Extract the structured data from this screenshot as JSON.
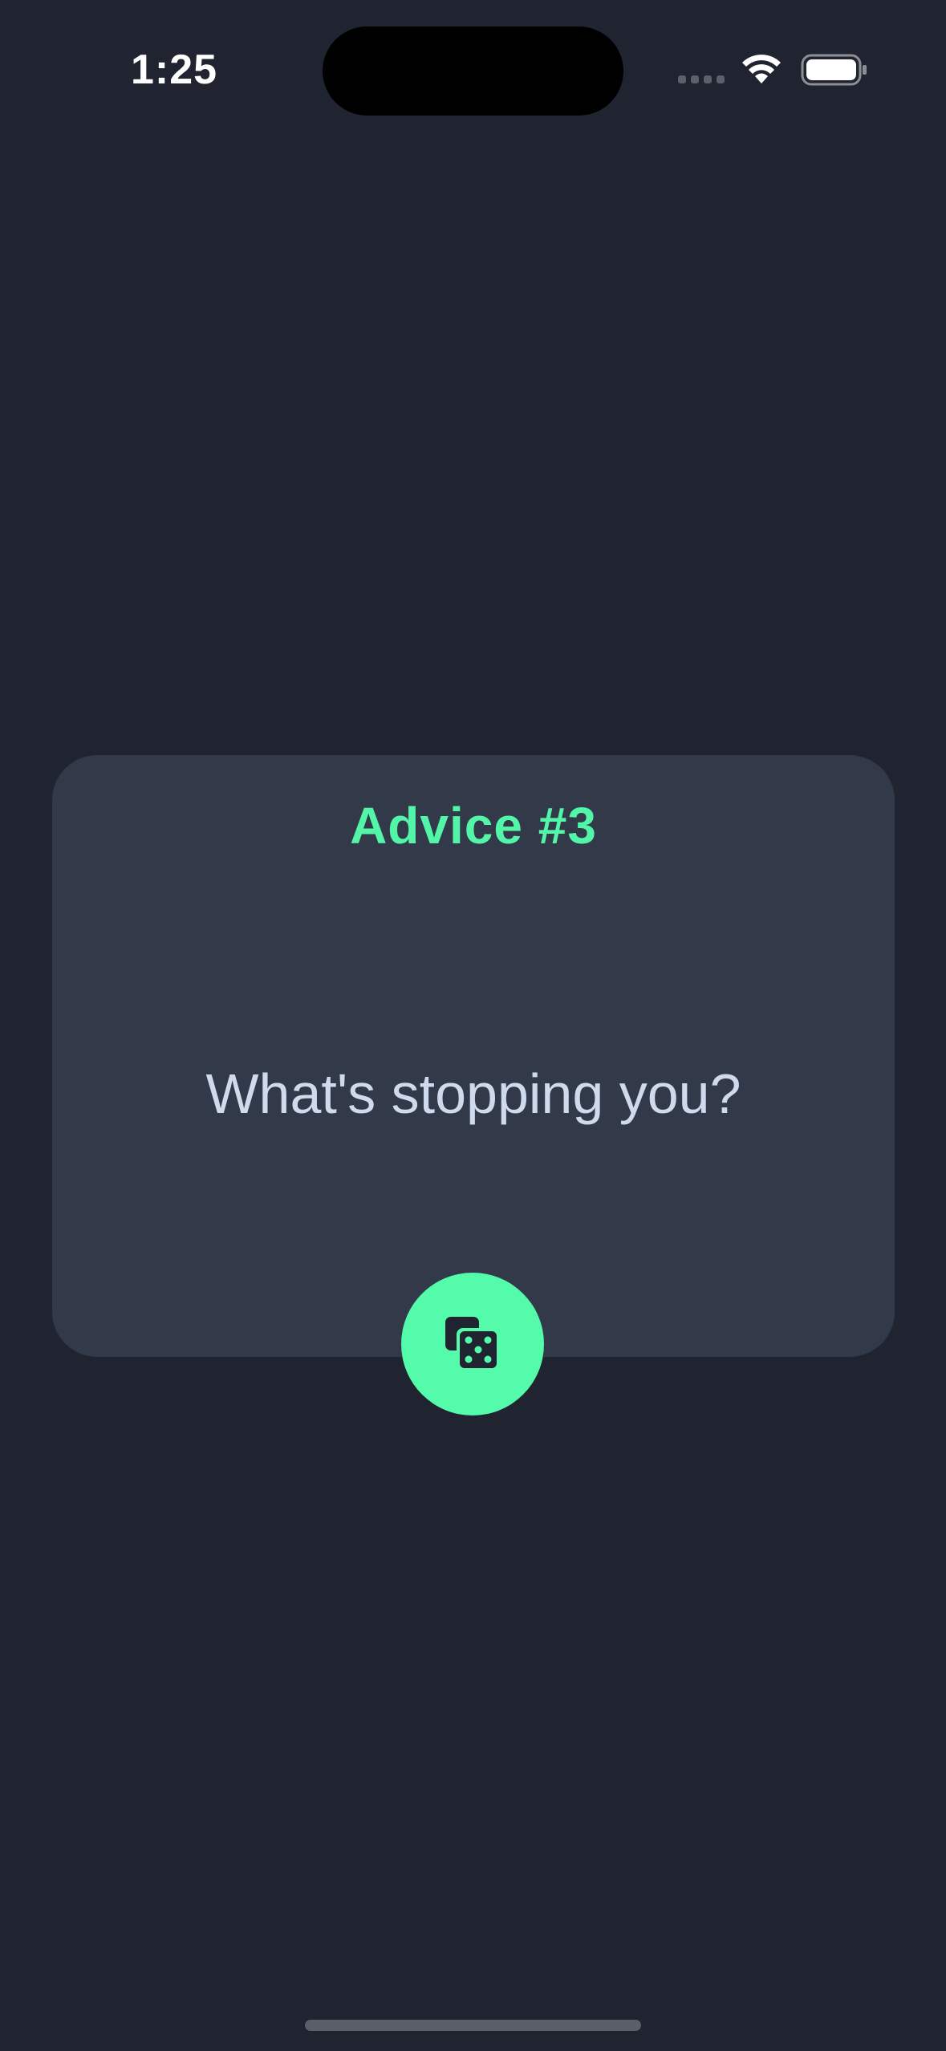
{
  "status_bar": {
    "time": "1:25",
    "icons": [
      "signal-icon",
      "wifi-icon",
      "battery-icon"
    ]
  },
  "card": {
    "title": "Advice #3",
    "quote": "What's stopping you?"
  },
  "action": {
    "icon": "dice-icon"
  },
  "colors": {
    "background": "#1f2430",
    "card": "#323a4a",
    "accent": "#53f6a8",
    "quote_text": "#cfdbec"
  }
}
